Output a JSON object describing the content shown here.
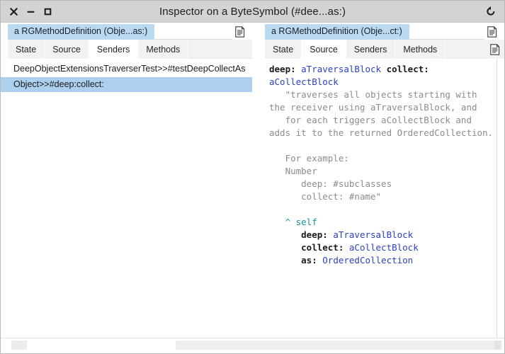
{
  "window": {
    "title": "Inspector on a ByteSymbol (#dee...as:)",
    "close_label": "×",
    "minimize_label": "−",
    "maximize_label": "□",
    "close_icon": "close-icon",
    "minimize_icon": "minimize-icon",
    "maximize_icon": "maximize-icon",
    "refresh_icon": "refresh-icon",
    "titlebar_color": "#d3d3d3"
  },
  "left_pane": {
    "object_tab": "a RGMethodDefinition (Obje...as:)",
    "doc_icon": "document-icon",
    "tabs": [
      {
        "label": "State",
        "selected": false
      },
      {
        "label": "Source",
        "selected": false
      },
      {
        "label": "Senders",
        "selected": true
      },
      {
        "label": "Methods",
        "selected": false
      }
    ],
    "senders": [
      {
        "label": "DeepObjectExtensionsTraverserTest>>#testDeepCollectAs",
        "selected": false
      },
      {
        "label": "Object>>#deep:collect:",
        "selected": true
      }
    ],
    "selection_color": "#aed0ef"
  },
  "right_pane": {
    "object_tab": "a RGMethodDefinition (Obje...ct:)",
    "doc_icon": "document-icon",
    "tabstrip_icon": "document-icon",
    "tabs": [
      {
        "label": "State",
        "selected": false
      },
      {
        "label": "Source",
        "selected": true
      },
      {
        "label": "Senders",
        "selected": false
      },
      {
        "label": "Methods",
        "selected": false
      }
    ],
    "source_segments": [
      {
        "text": "deep: ",
        "style": "kw"
      },
      {
        "text": "aTraversalBlock",
        "style": "var"
      },
      {
        "text": " ",
        "style": "plain"
      },
      {
        "text": "collect:",
        "style": "kw"
      },
      {
        "text": "\n",
        "style": "plain"
      },
      {
        "text": "aCollectBlock",
        "style": "var"
      },
      {
        "text": "\n   \"traverses all objects starting with the receiver using aTraversalBlock, and\n   for each triggers aCollectBlock and adds it to the returned OrderedCollection.\n\n   For example:\n   Number\n      deep: #subclasses\n      collect: #name\"",
        "style": "comment"
      },
      {
        "text": "\n\n   ",
        "style": "plain"
      },
      {
        "text": "^ self",
        "style": "ret"
      },
      {
        "text": "\n      ",
        "style": "plain"
      },
      {
        "text": "deep: ",
        "style": "kw"
      },
      {
        "text": "aTraversalBlock",
        "style": "var"
      },
      {
        "text": "\n      ",
        "style": "plain"
      },
      {
        "text": "collect: ",
        "style": "kw"
      },
      {
        "text": "aCollectBlock",
        "style": "var"
      },
      {
        "text": "\n      ",
        "style": "plain"
      },
      {
        "text": "as: ",
        "style": "kw"
      },
      {
        "text": "OrderedCollection",
        "style": "cls"
      }
    ],
    "colors": {
      "keyword": "#1a1a1a",
      "variable": "#2b3fc4",
      "comment": "#8c8c8c",
      "return": "#13949f"
    }
  },
  "bottom": {
    "left_scrollbar": "horizontal-scrollbar",
    "right_scrollbar": "horizontal-scrollbar"
  }
}
